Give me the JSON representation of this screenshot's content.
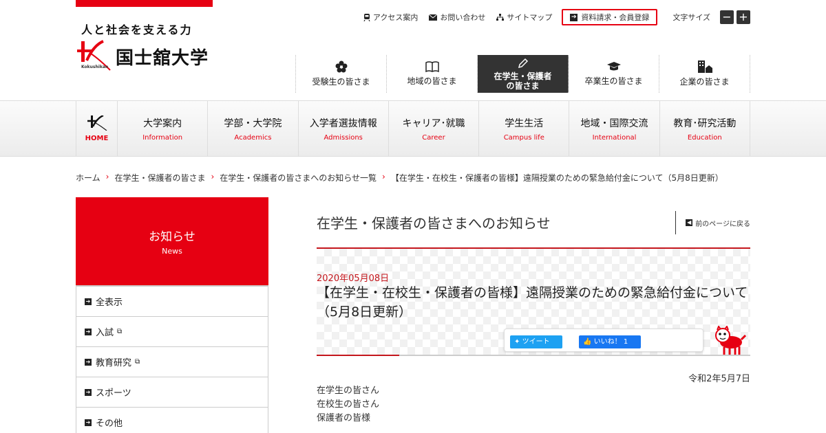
{
  "header": {
    "tagline": "人と社会を支える力",
    "logo_name": "国士舘大学",
    "logo_sub": "Kokushikan"
  },
  "utility": {
    "access": "アクセス案内",
    "contact": "お問い合わせ",
    "sitemap": "サイトマップ",
    "request": "資料請求・会員登録",
    "font_size_label": "文字サイズ",
    "font_smaller": "−",
    "font_larger": "+"
  },
  "target_nav": [
    {
      "label": "受験生の皆さま",
      "icon": "flower-icon"
    },
    {
      "label": "地域の皆さま",
      "icon": "book-icon"
    },
    {
      "label": "在学生・保護者の皆さま",
      "icon": "pencil-icon",
      "active": true
    },
    {
      "label": "卒業生の皆さま",
      "icon": "graduation-cap-icon"
    },
    {
      "label": "企業の皆さま",
      "icon": "building-icon"
    }
  ],
  "global_nav": {
    "home": "HOME",
    "items": [
      {
        "ja": "大学案内",
        "en": "Information"
      },
      {
        "ja": "学部・大学院",
        "en": "Academics"
      },
      {
        "ja": "入学者選抜情報",
        "en": "Admissions"
      },
      {
        "ja": "キャリア･就職",
        "en": "Career"
      },
      {
        "ja": "学生生活",
        "en": "Campus life"
      },
      {
        "ja": "地域・国際交流",
        "en": "International"
      },
      {
        "ja": "教育･研究活動",
        "en": "Education"
      }
    ]
  },
  "breadcrumb": [
    "ホーム",
    "在学生・保護者の皆さま",
    "在学生・保護者の皆さまへのお知らせ一覧",
    "【在学生・在校生・保護者の皆様】遠隔授業のための緊急給付金について（5月8日更新）"
  ],
  "sidebar": {
    "title_ja": "お知らせ",
    "title_en": "News",
    "items": [
      {
        "label": "全表示"
      },
      {
        "label": "入試",
        "external": true
      },
      {
        "label": "教育研究",
        "external": true
      },
      {
        "label": "スポーツ"
      },
      {
        "label": "その他"
      }
    ]
  },
  "main": {
    "heading": "在学生・保護者の皆さまへのお知らせ",
    "back_label": "前のページに戻る",
    "article": {
      "date": "2020年05月08日",
      "title": "【在学生・在校生・保護者の皆様】遠隔授業のための緊急給付金について（5月8日更新）",
      "tweet": "ツイート",
      "like": "いいね！ 1",
      "letter_date": "令和2年5月7日",
      "recipients": [
        "在学生の皆さん",
        "在校生の皆さん",
        "保護者の皆様"
      ]
    }
  },
  "colors": {
    "brand_red": "#e60012",
    "dark_nav": "#333333",
    "twitter": "#1da1f2",
    "facebook": "#1877f2"
  }
}
